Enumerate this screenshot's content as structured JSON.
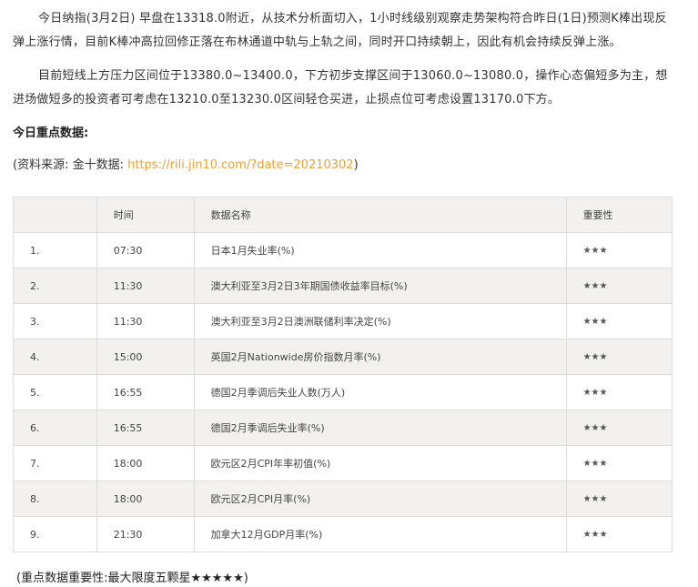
{
  "article": {
    "paragraph1": "今日纳指(3月2日) 早盘在13318.0附近，从技术分析面切入，1小时线级别观察走势架构符合昨日(1日)预测K棒出现反弹上涨行情，目前K棒冲高拉回修正落在布林通道中轨与上轨之间，同时开口持续朝上，因此有机会持续反弹上涨。",
    "paragraph2": "目前短线上方压力区间位于13380.0~13400.0，下方初步支撑区间于13060.0~13080.0，操作心态偏短多为主，想进场做短多的投资者可考虑在13210.0至13230.0区间轻仓买进，止损点位可考虑设置13170.0下方。",
    "section_title": "今日重点数据:",
    "source_prefix": "(资料来源: 金十数据: ",
    "source_link": "https://rili.jin10.com/?date=20210302",
    "source_suffix": ")"
  },
  "table": {
    "headers": [
      "",
      "时间",
      "数据名称",
      "重要性"
    ],
    "rows": [
      {
        "num": "1.",
        "time": "07:30",
        "name": "日本1月失业率(%)",
        "stars": "★★★"
      },
      {
        "num": "2.",
        "time": "11:30",
        "name": "澳大利亚至3月2日3年期国债收益率目标(%)",
        "stars": "★★★"
      },
      {
        "num": "3.",
        "time": "11:30",
        "name": "澳大利亚至3月2日澳洲联储利率决定(%)",
        "stars": "★★★"
      },
      {
        "num": "4.",
        "time": "15:00",
        "name": "英国2月Nationwide房价指数月率(%)",
        "stars": "★★★"
      },
      {
        "num": "5.",
        "time": "16:55",
        "name": "德国2月季调后失业人数(万人)",
        "stars": "★★★"
      },
      {
        "num": "6.",
        "time": "16:55",
        "name": "德国2月季调后失业率(%)",
        "stars": "★★★"
      },
      {
        "num": "7.",
        "time": "18:00",
        "name": "欧元区2月CPI年率初值(%)",
        "stars": "★★★"
      },
      {
        "num": "8.",
        "time": "18:00",
        "name": "欧元区2月CPI月率(%)",
        "stars": "★★★"
      },
      {
        "num": "9.",
        "time": "21:30",
        "name": "加拿大12月GDP月率(%)",
        "stars": "★★★"
      }
    ]
  },
  "footer_note": "(重点数据重要性:最大限度五颗星★★★★★)",
  "colors": {
    "link": "#e8a23a",
    "shade": "#f2f1ef",
    "border": "#dcdcdc"
  }
}
